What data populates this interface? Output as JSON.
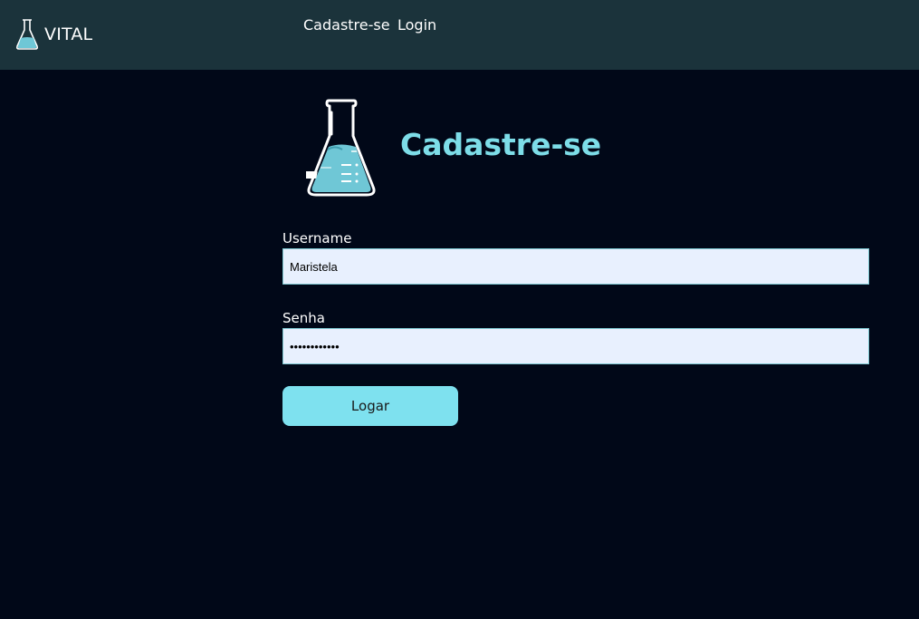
{
  "colors": {
    "page_background": "#010818",
    "navbar_background": "#1b333b",
    "accent": "#7ddde8",
    "button_background": "#7ee1ef",
    "input_background": "#e8f0fe"
  },
  "navbar": {
    "brand": {
      "name": "VITAL",
      "icon": "flask-icon"
    },
    "links": [
      {
        "label": "Cadastre-se"
      },
      {
        "label": "Login"
      }
    ]
  },
  "main": {
    "hero_icon": "flask-icon",
    "title": "Cadastre-se",
    "form": {
      "username": {
        "label": "Username",
        "value": "Maristela"
      },
      "senha": {
        "label": "Senha",
        "value": "••••••••••••"
      },
      "submit_label": "Logar"
    }
  }
}
